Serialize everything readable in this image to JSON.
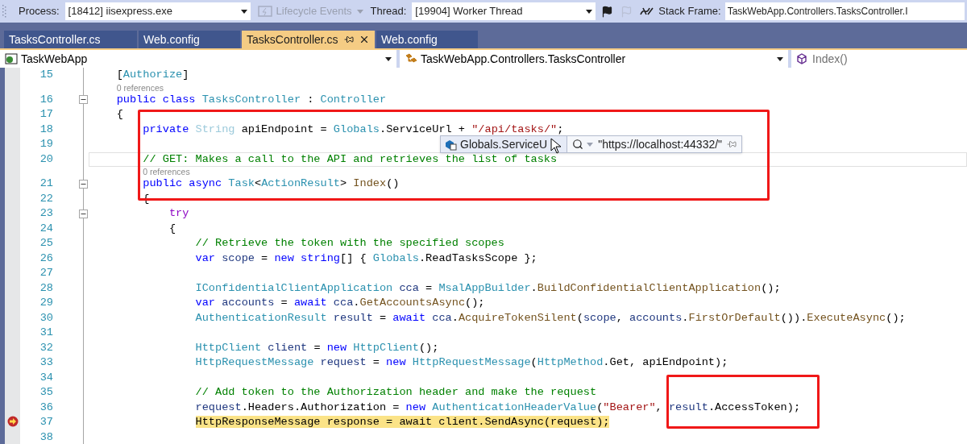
{
  "toolbar": {
    "process_label": "Process:",
    "process": "[18412] iisexpress.exe",
    "lifecycle": {
      "label": "Lifecycle Events",
      "disabled": true
    },
    "thread_label": "Thread:",
    "thread": "[19904] Worker Thread",
    "stack_frame_label": "Stack Frame:",
    "stack_frame": "TaskWebApp.Controllers.TasksController.I"
  },
  "tabs": [
    {
      "label": "TasksController.cs",
      "selected": false
    },
    {
      "label": "Web.config",
      "selected": false
    },
    {
      "label": "TasksController.cs",
      "selected": true
    },
    {
      "label": "Web.config",
      "selected": false
    }
  ],
  "navigation_bar": {
    "project": "TaskWebApp",
    "type": "TaskWebApp.Controllers.TasksController",
    "member": "Index()"
  },
  "editor": {
    "lines": [
      {
        "kind": "code",
        "number": "15",
        "collapsible": false,
        "current": false,
        "caret_line": false,
        "tokens": [
          {
            "kind": "plain",
            "text": "    ["
          },
          {
            "kind": "type",
            "text": "Authorize"
          },
          {
            "kind": "plain",
            "text": "]"
          }
        ]
      },
      {
        "kind": "lens",
        "text": "0 references"
      },
      {
        "kind": "code",
        "number": "16",
        "collapsible": true,
        "current": false,
        "caret_line": false,
        "tokens": [
          {
            "kind": "keyword",
            "text": "    public class "
          },
          {
            "kind": "type",
            "text": "TasksController"
          },
          {
            "kind": "plain",
            "text": " : "
          },
          {
            "kind": "type",
            "text": "Controller"
          }
        ]
      },
      {
        "kind": "code",
        "number": "17",
        "collapsible": false,
        "current": false,
        "caret_line": false,
        "tokens": [
          {
            "kind": "plain",
            "text": "    {"
          }
        ]
      },
      {
        "kind": "code",
        "number": "18",
        "collapsible": false,
        "current": false,
        "caret_line": false,
        "tokens": [
          {
            "kind": "keyword",
            "text": "        private "
          },
          {
            "kind": "faded",
            "text": "String"
          },
          {
            "kind": "plain",
            "text": " apiEndpoint = "
          },
          {
            "kind": "type",
            "text": "Globals"
          },
          {
            "kind": "plain",
            "text": ".ServiceUrl + "
          },
          {
            "kind": "string",
            "text": "\"/api/tasks/\""
          },
          {
            "kind": "plain",
            "text": ";"
          }
        ]
      },
      {
        "kind": "code",
        "number": "19",
        "collapsible": false,
        "current": false,
        "caret_line": false
      },
      {
        "kind": "code",
        "number": "20",
        "collapsible": false,
        "current": false,
        "caret_line": true,
        "tokens": [
          {
            "kind": "comment",
            "text": "        // GET: Makes a call to the API and retrieves the list of tasks"
          }
        ]
      },
      {
        "kind": "lens",
        "text": "0 references"
      },
      {
        "kind": "code",
        "number": "21",
        "collapsible": true,
        "current": false,
        "caret_line": false,
        "tokens": [
          {
            "kind": "keyword",
            "text": "        public async "
          },
          {
            "kind": "type",
            "text": "Task"
          },
          {
            "kind": "plain",
            "text": "<"
          },
          {
            "kind": "type",
            "text": "ActionResult"
          },
          {
            "kind": "plain",
            "text": "> "
          },
          {
            "kind": "method",
            "text": "Index"
          },
          {
            "kind": "plain",
            "text": "()"
          }
        ]
      },
      {
        "kind": "code",
        "number": "22",
        "collapsible": false,
        "current": false,
        "caret_line": false,
        "tokens": [
          {
            "kind": "plain",
            "text": "        {"
          }
        ]
      },
      {
        "kind": "code",
        "number": "23",
        "collapsible": true,
        "current": false,
        "caret_line": false,
        "tokens": [
          {
            "kind": "control",
            "text": "            try"
          }
        ]
      },
      {
        "kind": "code",
        "number": "24",
        "collapsible": false,
        "current": false,
        "caret_line": false,
        "tokens": [
          {
            "kind": "plain",
            "text": "            {"
          }
        ]
      },
      {
        "kind": "code",
        "number": "25",
        "collapsible": false,
        "current": false,
        "caret_line": false,
        "tokens": [
          {
            "kind": "comment",
            "text": "                // Retrieve the token with the specified scopes"
          }
        ]
      },
      {
        "kind": "code",
        "number": "26",
        "collapsible": false,
        "current": false,
        "caret_line": false,
        "tokens": [
          {
            "kind": "keyword",
            "text": "                var "
          },
          {
            "kind": "local",
            "text": "scope"
          },
          {
            "kind": "plain",
            "text": " = "
          },
          {
            "kind": "keyword",
            "text": "new string"
          },
          {
            "kind": "plain",
            "text": "[] { "
          },
          {
            "kind": "type",
            "text": "Globals"
          },
          {
            "kind": "plain",
            "text": ".ReadTasksScope };"
          }
        ]
      },
      {
        "kind": "code",
        "number": "27",
        "collapsible": false,
        "current": false,
        "caret_line": false
      },
      {
        "kind": "code",
        "number": "28",
        "collapsible": false,
        "current": false,
        "caret_line": false,
        "tokens": [
          {
            "kind": "type",
            "text": "                IConfidentialClientApplication"
          },
          {
            "kind": "local",
            "text": " cca"
          },
          {
            "kind": "plain",
            "text": " = "
          },
          {
            "kind": "type",
            "text": "MsalAppBuilder"
          },
          {
            "kind": "plain",
            "text": "."
          },
          {
            "kind": "method",
            "text": "BuildConfidentialClientApplication"
          },
          {
            "kind": "plain",
            "text": "();"
          }
        ]
      },
      {
        "kind": "code",
        "number": "29",
        "collapsible": false,
        "current": false,
        "caret_line": false,
        "tokens": [
          {
            "kind": "keyword",
            "text": "                var "
          },
          {
            "kind": "local",
            "text": "accounts"
          },
          {
            "kind": "plain",
            "text": " = "
          },
          {
            "kind": "keyword",
            "text": "await "
          },
          {
            "kind": "local",
            "text": "cca"
          },
          {
            "kind": "plain",
            "text": "."
          },
          {
            "kind": "method",
            "text": "GetAccountsAsync"
          },
          {
            "kind": "plain",
            "text": "();"
          }
        ]
      },
      {
        "kind": "code",
        "number": "30",
        "collapsible": false,
        "current": false,
        "caret_line": false,
        "tokens": [
          {
            "kind": "type",
            "text": "                AuthenticationResult"
          },
          {
            "kind": "local",
            "text": " result"
          },
          {
            "kind": "plain",
            "text": " = "
          },
          {
            "kind": "keyword",
            "text": "await "
          },
          {
            "kind": "local",
            "text": "cca"
          },
          {
            "kind": "plain",
            "text": "."
          },
          {
            "kind": "method",
            "text": "AcquireTokenSilent"
          },
          {
            "kind": "plain",
            "text": "("
          },
          {
            "kind": "local",
            "text": "scope"
          },
          {
            "kind": "plain",
            "text": ", "
          },
          {
            "kind": "local",
            "text": "accounts"
          },
          {
            "kind": "plain",
            "text": "."
          },
          {
            "kind": "method",
            "text": "FirstOrDefault"
          },
          {
            "kind": "plain",
            "text": "())."
          },
          {
            "kind": "method",
            "text": "ExecuteAsync"
          },
          {
            "kind": "plain",
            "text": "();"
          }
        ]
      },
      {
        "kind": "code",
        "number": "31",
        "collapsible": false,
        "current": false,
        "caret_line": false
      },
      {
        "kind": "code",
        "number": "32",
        "collapsible": false,
        "current": false,
        "caret_line": false,
        "tokens": [
          {
            "kind": "type",
            "text": "                HttpClient"
          },
          {
            "kind": "local",
            "text": " client"
          },
          {
            "kind": "plain",
            "text": " = "
          },
          {
            "kind": "keyword",
            "text": "new "
          },
          {
            "kind": "type",
            "text": "HttpClient"
          },
          {
            "kind": "plain",
            "text": "();"
          }
        ]
      },
      {
        "kind": "code",
        "number": "33",
        "collapsible": false,
        "current": false,
        "caret_line": false,
        "tokens": [
          {
            "kind": "type",
            "text": "                HttpRequestMessage"
          },
          {
            "kind": "local",
            "text": " request"
          },
          {
            "kind": "plain",
            "text": " = "
          },
          {
            "kind": "keyword",
            "text": "new "
          },
          {
            "kind": "type",
            "text": "HttpRequestMessage"
          },
          {
            "kind": "plain",
            "text": "("
          },
          {
            "kind": "type",
            "text": "HttpMethod"
          },
          {
            "kind": "plain",
            "text": ".Get, apiEndpoint);"
          }
        ]
      },
      {
        "kind": "code",
        "number": "34",
        "collapsible": false,
        "current": false,
        "caret_line": false
      },
      {
        "kind": "code",
        "number": "35",
        "collapsible": false,
        "current": false,
        "caret_line": false,
        "tokens": [
          {
            "kind": "comment",
            "text": "                // Add token to the Authorization header and make the request"
          }
        ]
      },
      {
        "kind": "code",
        "number": "36",
        "collapsible": false,
        "current": false,
        "caret_line": false,
        "tokens": [
          {
            "kind": "local",
            "text": "                request"
          },
          {
            "kind": "plain",
            "text": ".Headers.Authorization = "
          },
          {
            "kind": "keyword",
            "text": "new "
          },
          {
            "kind": "type",
            "text": "AuthenticationHeaderValue"
          },
          {
            "kind": "plain",
            "text": "("
          },
          {
            "kind": "string",
            "text": "\"Bearer\""
          },
          {
            "kind": "plain",
            "text": ", "
          },
          {
            "kind": "local",
            "text": "result"
          },
          {
            "kind": "plain",
            "text": ".AccessToken);"
          }
        ]
      },
      {
        "kind": "code",
        "number": "37",
        "collapsible": false,
        "current": true,
        "caret_line": false,
        "text": "                HttpResponseMessage response = await client.SendAsync(request);"
      },
      {
        "kind": "code",
        "number": "38",
        "collapsible": false,
        "current": false,
        "caret_line": false
      }
    ],
    "data_tip": {
      "expression": "Globals.ServiceU",
      "value": "\"https://localhost:44332/\""
    }
  }
}
